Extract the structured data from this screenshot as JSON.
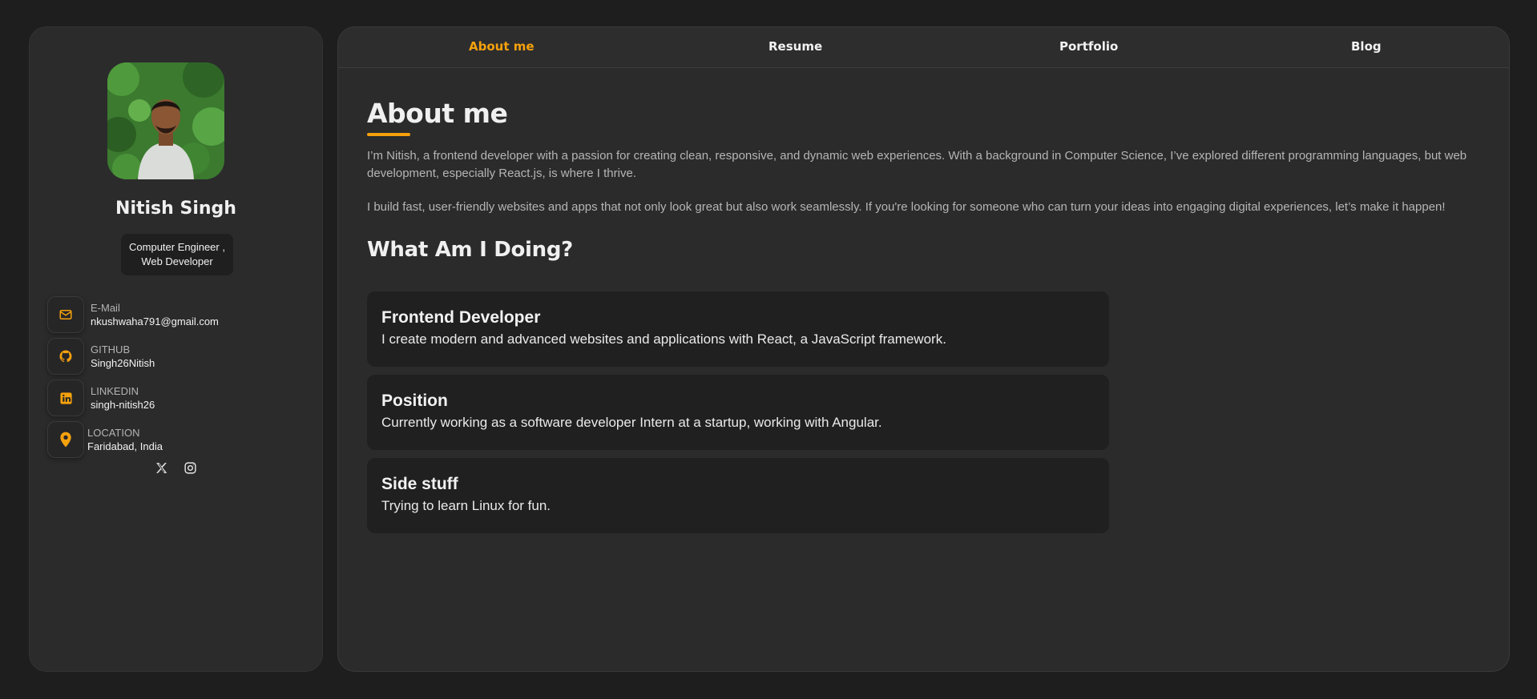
{
  "profile": {
    "name": "Nitish Singh",
    "role_line1": "Computer Engineer ,",
    "role_line2": "Web Developer"
  },
  "contacts": [
    {
      "label": "E-Mail",
      "value": "nkushwaha791@gmail.com",
      "icon": "mail-icon"
    },
    {
      "label": "GITHUB",
      "value": "Singh26Nitish",
      "icon": "github-icon"
    },
    {
      "label": "LINKEDIN",
      "value": "singh-nitish26",
      "icon": "linkedin-icon"
    },
    {
      "label": "LOCATION",
      "value": "Faridabad, India",
      "icon": "location-pin-icon"
    }
  ],
  "socials": [
    {
      "icon": "x-twitter-icon"
    },
    {
      "icon": "instagram-icon"
    }
  ],
  "nav": {
    "items": [
      {
        "label": "About me",
        "active": true
      },
      {
        "label": "Resume",
        "active": false
      },
      {
        "label": "Portfolio",
        "active": false
      },
      {
        "label": "Blog",
        "active": false
      }
    ]
  },
  "about": {
    "title": "About me",
    "paragraph1": "I’m Nitish, a frontend developer with a passion for creating clean, responsive, and dynamic web experiences. With a background in Computer Science, I’ve explored different programming languages, but web development, especially React.js, is where I thrive.",
    "paragraph2": "I build fast, user-friendly websites and apps that not only look great but also work seamlessly. If you're looking for someone who can turn your ideas into engaging digital experiences, let’s make it happen!",
    "section_title": "What Am I Doing?",
    "cards": [
      {
        "title": "Frontend Developer",
        "desc": "I create modern and advanced websites and applications with React, a JavaScript framework."
      },
      {
        "title": "Position",
        "desc": "Currently working as a software developer Intern at a startup, working with Angular."
      },
      {
        "title": "Side stuff",
        "desc": "Trying to learn Linux for fun."
      }
    ]
  },
  "colors": {
    "accent": "#f5a10d",
    "background": "#1e1e1f",
    "panel": "#2b2b2c",
    "card": "#202021"
  }
}
